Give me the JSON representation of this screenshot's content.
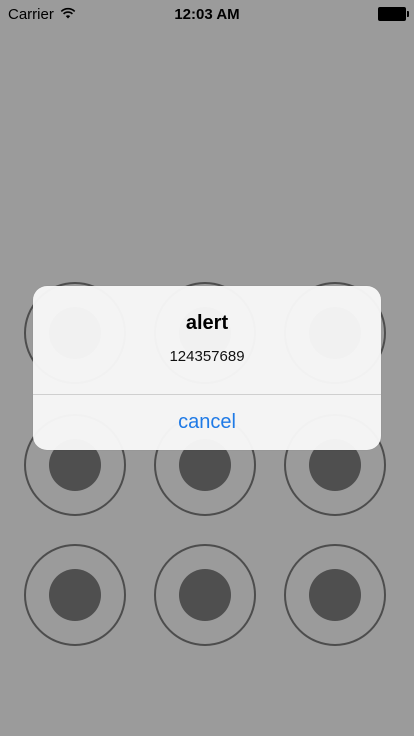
{
  "status_bar": {
    "carrier": "Carrier",
    "time": "12:03 AM",
    "icons": [
      "wifi-icon",
      "battery-icon"
    ]
  },
  "grid": {
    "rows": 3,
    "cols": 3
  },
  "alert": {
    "title": "alert",
    "message": "124357689",
    "button_label": "cancel"
  },
  "colors": {
    "background": "#9b9b9b",
    "node_stroke": "#4d4d4d",
    "node_dot": "#4f4f4f",
    "button_blue": "#1f7ae6"
  }
}
